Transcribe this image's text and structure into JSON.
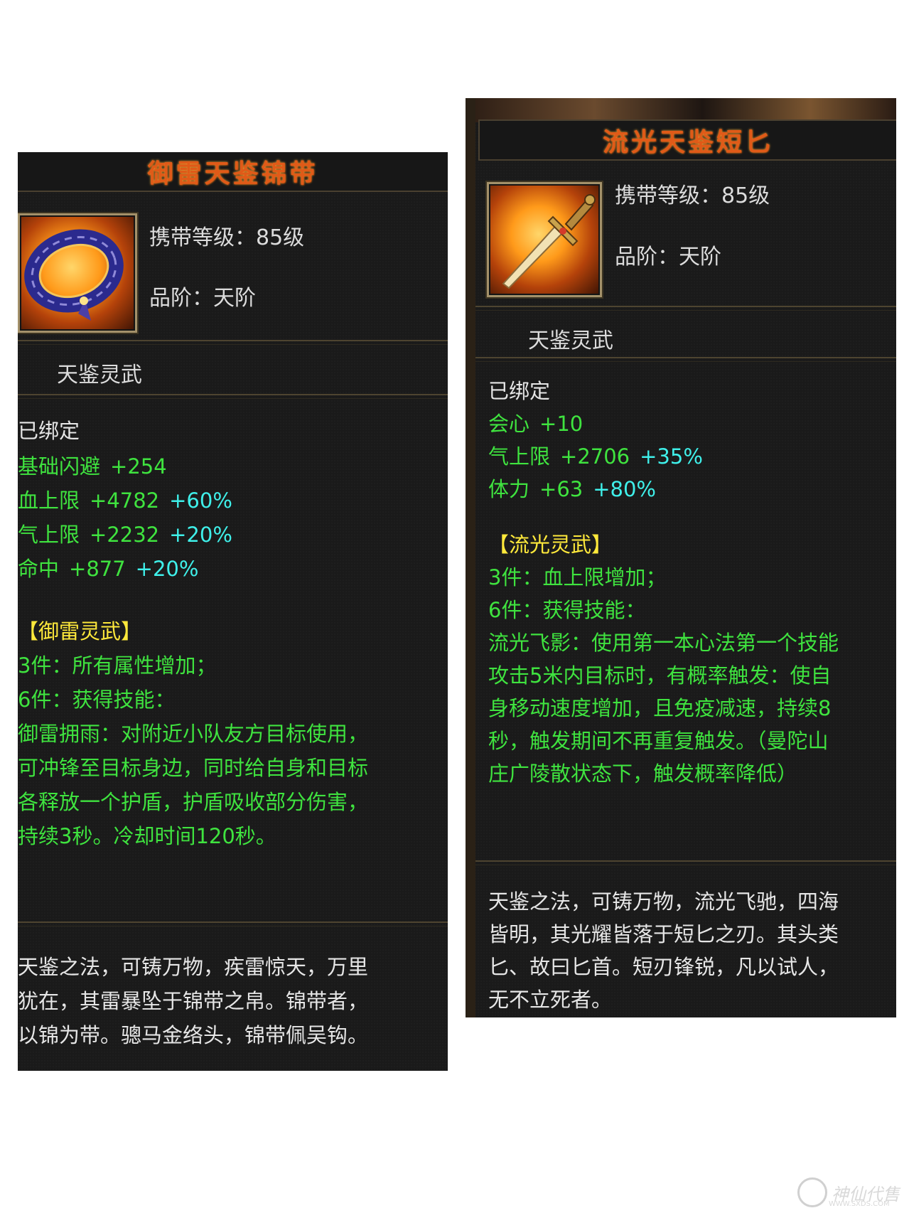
{
  "left_item": {
    "title": "御雷天鉴锦带",
    "carry_level": "携带等级：85级",
    "grade": "品阶：天阶",
    "subtype": "天鉴灵武",
    "bound": "已绑定",
    "stats": [
      {
        "name": "基础闪避",
        "value": "+254",
        "percent": ""
      },
      {
        "name": "血上限",
        "value": "+4782",
        "percent": "+60%"
      },
      {
        "name": "气上限",
        "value": "+2232",
        "percent": "+20%"
      },
      {
        "name": "命中",
        "value": "+877",
        "percent": "+20%"
      }
    ],
    "set_name": "【御雷灵武】",
    "set_effects": [
      "3件：所有属性增加；",
      "6件：获得技能：",
      "御雷拥雨：对附近小队友方目标使用，",
      "可冲锋至目标身边，同时给自身和目标",
      "各释放一个护盾，护盾吸收部分伤害，",
      "持续3秒。冷却时间120秒。"
    ],
    "description": [
      "天鉴之法，可铸万物，疾雷惊天，万里",
      "犹在，其雷暴坠于锦带之帛。锦带者，",
      "以锦为带。骢马金络头，锦带佩吴钩。"
    ],
    "icon": "jade-belt-icon"
  },
  "right_item": {
    "title": "流光天鉴短匕",
    "carry_level": "携带等级：85级",
    "grade": "品阶：天阶",
    "subtype": "天鉴灵武",
    "bound": "已绑定",
    "stats": [
      {
        "name": "会心",
        "value": "+10",
        "percent": ""
      },
      {
        "name": "气上限",
        "value": "+2706",
        "percent": "+35%"
      },
      {
        "name": "体力",
        "value": "+63",
        "percent": "+80%"
      }
    ],
    "set_name": "【流光灵武】",
    "set_effects": [
      "3件：血上限增加；",
      "6件：获得技能：",
      "流光飞影：使用第一本心法第一个技能",
      "攻击5米内目标时，有概率触发：使自",
      "身移动速度增加，且免疫减速，持续8",
      "秒，触发期间不再重复触发。（曼陀山",
      "庄广陵散状态下，触发概率降低）"
    ],
    "description": [
      "天鉴之法，可铸万物，流光飞驰，四海",
      "皆明，其光耀皆落于短匕之刃。其头类",
      "匕、故曰匕首。短刃锋锐，凡以试人，",
      "无不立死者。"
    ],
    "icon": "dagger-icon"
  },
  "watermark": {
    "text": "神仙代售",
    "url": "WWW.SXDS.COM",
    "icon": "mascot-logo-icon"
  },
  "colors": {
    "title": "#e05a18",
    "panel_bg": "#1a1a1a",
    "stat_base": "#3fe33f",
    "stat_percent": "#3ff0ea",
    "set_name": "#ffe93b",
    "text": "#e6e6e6"
  }
}
